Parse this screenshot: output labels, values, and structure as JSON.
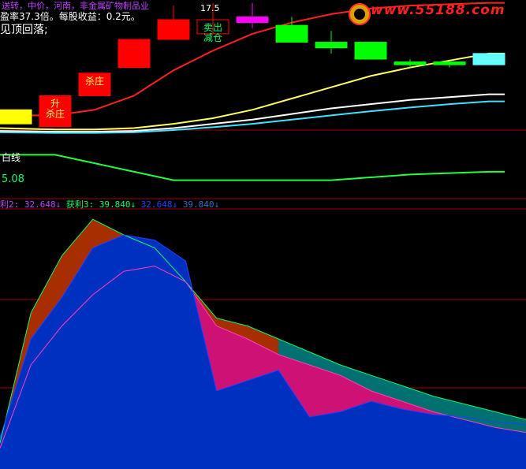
{
  "header": {
    "line1": "送转，中价，河南，非金属矿物制品业",
    "line2": "盈率37.3倍。每股收益：0.2元。",
    "line3": "见顶回落;"
  },
  "watermark": {
    "text": "www.55188.com"
  },
  "price_label": "17.5",
  "left_value": "5.08",
  "left_tag": "白线",
  "indicator_row": [
    {
      "text": "利2: 32.648↓",
      "color": "#c040ff"
    },
    {
      "text": "获利3: 39.840↓",
      "color": "#00ff66"
    },
    {
      "text": "32.648↓",
      "color": "#2040ff"
    },
    {
      "text": "39.840↓",
      "color": "#3070c0"
    }
  ],
  "chart_data": [
    {
      "type": "candlestick",
      "ylim": [
        11.0,
        18.0
      ],
      "candles": [
        {
          "open": 14.1,
          "close": 13.6,
          "high": 14.1,
          "low": 13.6,
          "color": "#ffff00",
          "label": ""
        },
        {
          "open": 13.5,
          "close": 14.6,
          "high": 14.6,
          "low": 13.5,
          "color": "#ff0000",
          "label": "升\n杀庄"
        },
        {
          "open": 14.6,
          "close": 15.4,
          "high": 15.4,
          "low": 14.6,
          "color": "#ff0000",
          "label": "杀庄"
        },
        {
          "open": 15.6,
          "close": 16.6,
          "high": 16.6,
          "low": 15.6,
          "color": "#ff0000",
          "label": ""
        },
        {
          "open": 16.6,
          "close": 17.3,
          "high": 17.8,
          "low": 16.6,
          "color": "#ff0000",
          "label": ""
        },
        {
          "open": 17.3,
          "close": 16.8,
          "high": 17.9,
          "low": 16.8,
          "color": "#ff0000",
          "label": "卖出\n减仓"
        },
        {
          "open": 17.4,
          "close": 17.2,
          "high": 17.9,
          "low": 17.0,
          "color": "#ff00ff",
          "label": ""
        },
        {
          "open": 17.1,
          "close": 16.5,
          "high": 17.4,
          "low": 16.5,
          "color": "#00ff00",
          "label": ""
        },
        {
          "open": 16.5,
          "close": 16.3,
          "high": 16.9,
          "low": 16.1,
          "color": "#00ff00",
          "label": ""
        },
        {
          "open": 16.5,
          "close": 15.9,
          "high": 16.5,
          "low": 15.9,
          "color": "#00ff00",
          "label": ""
        },
        {
          "open": 15.8,
          "close": 15.7,
          "high": 15.9,
          "low": 15.6,
          "color": "#00ff00",
          "label": ""
        },
        {
          "open": 15.8,
          "close": 15.7,
          "high": 15.8,
          "low": 15.6,
          "color": "#00ff00",
          "label": ""
        },
        {
          "open": 15.7,
          "close": 16.1,
          "high": 16.1,
          "low": 15.7,
          "color": "#66ffff",
          "label": ""
        }
      ],
      "lines": [
        {
          "name": "red",
          "color": "#ff2020",
          "values": [
            13.9,
            13.9,
            14.1,
            14.6,
            15.5,
            16.2,
            16.8,
            17.2,
            17.5,
            17.7,
            17.8,
            17.85,
            17.9
          ]
        },
        {
          "name": "yellow",
          "color": "#ffff60",
          "values": [
            13.45,
            13.4,
            13.4,
            13.45,
            13.6,
            13.8,
            14.1,
            14.5,
            14.9,
            15.3,
            15.6,
            15.85,
            16.1
          ]
        },
        {
          "name": "white",
          "color": "#ffffff",
          "values": [
            13.35,
            13.32,
            13.32,
            13.35,
            13.45,
            13.6,
            13.75,
            13.95,
            14.15,
            14.3,
            14.45,
            14.55,
            14.65
          ]
        },
        {
          "name": "cyan",
          "color": "#40e0ff",
          "values": [
            13.3,
            13.28,
            13.28,
            13.3,
            13.38,
            13.48,
            13.6,
            13.75,
            13.9,
            14.05,
            14.18,
            14.3,
            14.4
          ]
        },
        {
          "name": "green",
          "color": "#20ff40",
          "values": [
            12.5,
            12.5,
            12.2,
            11.9,
            11.6,
            11.6,
            11.6,
            11.6,
            11.6,
            11.7,
            11.8,
            11.85,
            11.9
          ]
        }
      ]
    },
    {
      "type": "area",
      "ylim": [
        0,
        100
      ],
      "x": [
        0,
        1,
        2,
        3,
        4,
        5,
        6,
        7,
        8,
        9,
        10,
        11,
        12,
        13,
        14,
        15,
        16,
        17
      ],
      "series": [
        {
          "name": "获利3",
          "color": "#00ff66",
          "values": [
            10,
            60,
            82,
            96,
            90,
            85,
            72,
            58,
            55,
            50,
            45,
            40,
            36,
            32,
            28,
            25,
            22,
            19
          ]
        },
        {
          "name": "利2",
          "color": "#ff40c0",
          "values": [
            8,
            40,
            55,
            67,
            76,
            78,
            72,
            55,
            50,
            44,
            40,
            36,
            30,
            26,
            22,
            19,
            16,
            14
          ]
        },
        {
          "name": "blue",
          "color": "#2040ff",
          "values": [
            12,
            50,
            66,
            85,
            90,
            88,
            80,
            30,
            34,
            38,
            20,
            22,
            26,
            23,
            21,
            20,
            18,
            17
          ]
        }
      ]
    }
  ],
  "colors": {
    "background": "#000000",
    "separator": "#a00000",
    "area_upper": "#b03000",
    "area_pink": "#d0107a",
    "area_blue": "#0030c0",
    "area_teal": "#007070"
  }
}
